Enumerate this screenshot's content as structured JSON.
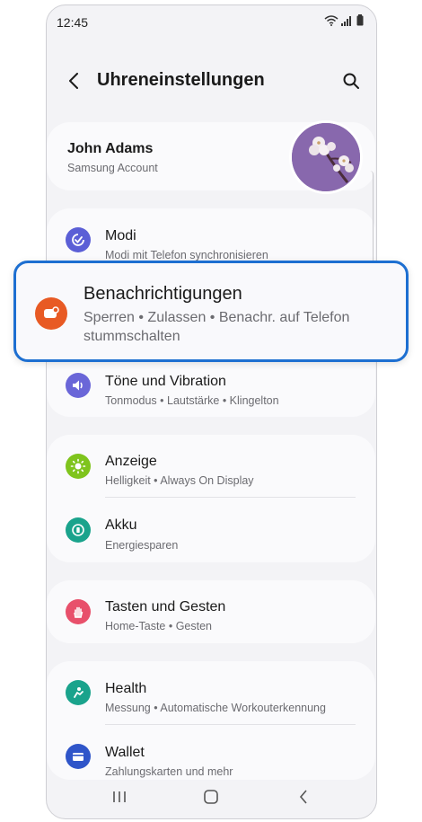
{
  "status_bar": {
    "time": "12:45"
  },
  "app_bar": {
    "title": "Uhreneinstellungen"
  },
  "account": {
    "name": "John Adams",
    "subtitle": "Samsung Account"
  },
  "highlighted_item": {
    "label": "Benachrichtigungen",
    "subtitle": "Sperren • Zulassen • Benachr. auf Telefon stummschalten",
    "icon": "notification-icon",
    "color": "#e85a24"
  },
  "items": [
    {
      "label": "Modi",
      "subtitle": "Modi mit Telefon synchronisieren",
      "icon": "modes-icon",
      "color": "#5b5fd6"
    },
    {
      "label": "Töne und Vibration",
      "subtitle": "Tonmodus • Lautstärke • Klingelton",
      "icon": "sound-icon",
      "color": "#6a66d8"
    },
    {
      "label": "Anzeige",
      "subtitle": "Helligkeit • Always On Display",
      "icon": "display-icon",
      "color": "#7fc41d"
    },
    {
      "label": "Akku",
      "subtitle": "Energiesparen",
      "icon": "battery-icon",
      "color": "#1aa38c"
    },
    {
      "label": "Tasten und Gesten",
      "subtitle": "Home-Taste • Gesten",
      "icon": "gesture-icon",
      "color": "#e8506b"
    },
    {
      "label": "Health",
      "subtitle": "Messung • Automatische Workouterkennung",
      "icon": "health-icon",
      "color": "#1aa38c"
    },
    {
      "label": "Wallet",
      "subtitle": "Zahlungskarten und mehr",
      "icon": "wallet-icon",
      "color": "#2f55c9"
    }
  ],
  "highlight_color": "#1d6fd1"
}
